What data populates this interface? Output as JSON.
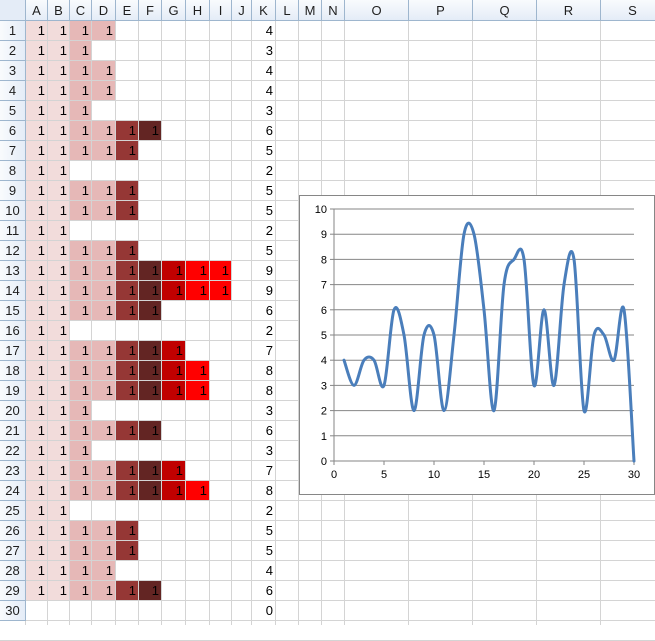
{
  "columns": [
    "A",
    "B",
    "C",
    "D",
    "E",
    "F",
    "G",
    "H",
    "I",
    "J",
    "K",
    "L",
    "M",
    "N",
    "O",
    "P",
    "Q",
    "R",
    "S"
  ],
  "rows": [
    {
      "n": "1",
      "k": "4",
      "cells": [
        "1",
        "1",
        "1",
        "1"
      ]
    },
    {
      "n": "2",
      "k": "3",
      "cells": [
        "1",
        "1",
        "1"
      ]
    },
    {
      "n": "3",
      "k": "4",
      "cells": [
        "1",
        "1",
        "1",
        "1"
      ]
    },
    {
      "n": "4",
      "k": "4",
      "cells": [
        "1",
        "1",
        "1",
        "1"
      ]
    },
    {
      "n": "5",
      "k": "3",
      "cells": [
        "1",
        "1",
        "1"
      ]
    },
    {
      "n": "6",
      "k": "6",
      "cells": [
        "1",
        "1",
        "1",
        "1",
        "1",
        "1"
      ]
    },
    {
      "n": "7",
      "k": "5",
      "cells": [
        "1",
        "1",
        "1",
        "1",
        "1"
      ]
    },
    {
      "n": "8",
      "k": "2",
      "cells": [
        "1",
        "1"
      ]
    },
    {
      "n": "9",
      "k": "5",
      "cells": [
        "1",
        "1",
        "1",
        "1",
        "1"
      ]
    },
    {
      "n": "10",
      "k": "5",
      "cells": [
        "1",
        "1",
        "1",
        "1",
        "1"
      ]
    },
    {
      "n": "11",
      "k": "2",
      "cells": [
        "1",
        "1"
      ]
    },
    {
      "n": "12",
      "k": "5",
      "cells": [
        "1",
        "1",
        "1",
        "1",
        "1"
      ]
    },
    {
      "n": "13",
      "k": "9",
      "cells": [
        "1",
        "1",
        "1",
        "1",
        "1",
        "1",
        "1",
        "1",
        "1"
      ]
    },
    {
      "n": "14",
      "k": "9",
      "cells": [
        "1",
        "1",
        "1",
        "1",
        "1",
        "1",
        "1",
        "1",
        "1"
      ]
    },
    {
      "n": "15",
      "k": "6",
      "cells": [
        "1",
        "1",
        "1",
        "1",
        "1",
        "1"
      ]
    },
    {
      "n": "16",
      "k": "2",
      "cells": [
        "1",
        "1"
      ]
    },
    {
      "n": "17",
      "k": "7",
      "cells": [
        "1",
        "1",
        "1",
        "1",
        "1",
        "1",
        "1"
      ]
    },
    {
      "n": "18",
      "k": "8",
      "cells": [
        "1",
        "1",
        "1",
        "1",
        "1",
        "1",
        "1",
        "1"
      ]
    },
    {
      "n": "19",
      "k": "8",
      "cells": [
        "1",
        "1",
        "1",
        "1",
        "1",
        "1",
        "1",
        "1"
      ]
    },
    {
      "n": "20",
      "k": "3",
      "cells": [
        "1",
        "1",
        "1"
      ]
    },
    {
      "n": "21",
      "k": "6",
      "cells": [
        "1",
        "1",
        "1",
        "1",
        "1",
        "1"
      ]
    },
    {
      "n": "22",
      "k": "3",
      "cells": [
        "1",
        "1",
        "1"
      ]
    },
    {
      "n": "23",
      "k": "7",
      "cells": [
        "1",
        "1",
        "1",
        "1",
        "1",
        "1",
        "1"
      ]
    },
    {
      "n": "24",
      "k": "8",
      "cells": [
        "1",
        "1",
        "1",
        "1",
        "1",
        "1",
        "1",
        "1"
      ]
    },
    {
      "n": "25",
      "k": "2",
      "cells": [
        "1",
        "1"
      ]
    },
    {
      "n": "26",
      "k": "5",
      "cells": [
        "1",
        "1",
        "1",
        "1",
        "1"
      ]
    },
    {
      "n": "27",
      "k": "5",
      "cells": [
        "1",
        "1",
        "1",
        "1",
        "1"
      ]
    },
    {
      "n": "28",
      "k": "4",
      "cells": [
        "1",
        "1",
        "1",
        "1"
      ]
    },
    {
      "n": "29",
      "k": "6",
      "cells": [
        "1",
        "1",
        "1",
        "1",
        "1",
        "1"
      ]
    },
    {
      "n": "30",
      "k": "0",
      "cells": []
    }
  ],
  "fill_colors": {
    "light": "#f2dcdb",
    "medium": "#e6b8b7",
    "dark": "#953735",
    "darker": "#632523",
    "deep": "#c00000",
    "bright": "#ff0000"
  },
  "chart_data": {
    "type": "line",
    "title": "",
    "xlabel": "",
    "ylabel": "",
    "smooth": true,
    "color": "#4a7ebb",
    "x": [
      1,
      2,
      3,
      4,
      5,
      6,
      7,
      8,
      9,
      10,
      11,
      12,
      13,
      14,
      15,
      16,
      17,
      18,
      19,
      20,
      21,
      22,
      23,
      24,
      25,
      26,
      27,
      28,
      29,
      30
    ],
    "values": [
      4,
      3,
      4,
      4,
      3,
      6,
      5,
      2,
      5,
      5,
      2,
      5,
      9,
      9,
      6,
      2,
      7,
      8,
      8,
      3,
      6,
      3,
      7,
      8,
      2,
      5,
      5,
      4,
      6,
      0
    ],
    "xlim": [
      0,
      30
    ],
    "ylim": [
      0,
      10
    ],
    "x_ticks": [
      "0",
      "5",
      "10",
      "15",
      "20",
      "25",
      "30"
    ],
    "y_ticks": [
      "0",
      "1",
      "2",
      "3",
      "4",
      "5",
      "6",
      "7",
      "8",
      "9",
      "10"
    ],
    "grid": "horizontal",
    "legend": "none"
  }
}
